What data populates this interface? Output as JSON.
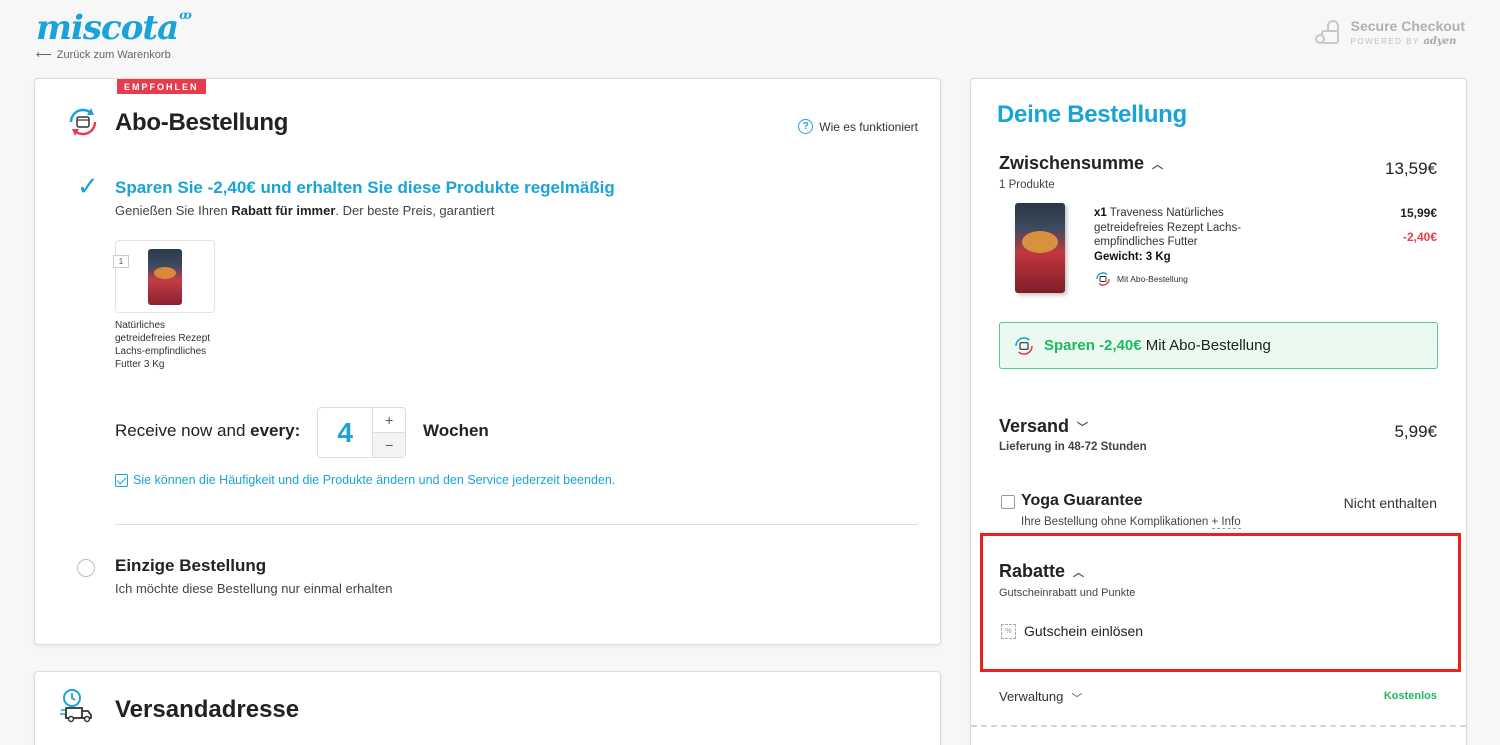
{
  "header": {
    "logo": "miscota",
    "back_link": "Zurück zum Warenkorb",
    "secure_title": "Secure Checkout",
    "secure_powered": "POWERED BY",
    "secure_brand": "adyen"
  },
  "abo": {
    "badge": "EMPFOHLEN",
    "title": "Abo-Bestellung",
    "how_link": "Wie es funktioniert",
    "save_title": "Sparen Sie -2,40€ und erhalten Sie diese Produkte regelmäßig",
    "save_sub_pre": "Genießen Sie Ihren ",
    "save_sub_bold": "Rabatt für immer",
    "save_sub_post": ". Der beste Preis, garantiert",
    "product_qty": "1",
    "product_name": "Natürliches getreidefreies Rezept Lachs-empfindliches Futter 3 Kg",
    "receive_pre": "Receive now and ",
    "receive_bold": "every:",
    "interval_value": "4",
    "plus": "+",
    "minus": "−",
    "interval_unit": "Wochen",
    "freq_note": "Sie können die Häufigkeit und die Produkte ändern und den Service jederzeit beenden.",
    "single_title": "Einzige Bestellung",
    "single_sub": "Ich möchte diese Bestellung nur einmal erhalten"
  },
  "shipping_card": {
    "title": "Versandadresse"
  },
  "order": {
    "title": "Deine Bestellung",
    "subtotal_label": "Zwischensumme",
    "subtotal_count": "1 Produkte",
    "subtotal_amount": "13,59€",
    "item_qty": "x1",
    "item_name": "Traveness Natürliches getreidefreies Rezept Lachs-empfindliches Futter",
    "item_weight": "Gewicht: 3 Kg",
    "item_abo": "Mit Abo-Bestellung",
    "item_price": "15,99€",
    "item_discount": "-2,40€",
    "save_box_bold": "Sparen -2,40€",
    "save_box_text": " Mit Abo-Bestellung",
    "shipping_label": "Versand",
    "shipping_sub": "Lieferung in 48-72 Stunden",
    "shipping_amount": "5,99€",
    "yoga_title": "Yoga Guarantee",
    "yoga_sub": "Ihre Bestellung ohne Komplikationen ",
    "yoga_info": "+ Info",
    "yoga_status": "Nicht enthalten",
    "discounts_label": "Rabatte",
    "discounts_sub": "Gutscheinrabatt und Punkte",
    "coupon_label": "Gutschein einlösen",
    "admin_label": "Verwaltung",
    "admin_value": "Kostenlos"
  },
  "colors": {
    "accent": "#1aa3d8",
    "badge": "#e73c4e",
    "success": "#20b860",
    "highlight": "#e8221f"
  },
  "icons": [
    "abo-cycle-icon",
    "question-icon",
    "check-icon",
    "delivery-clock-icon",
    "chevron-up-icon",
    "chevron-down-icon",
    "coupon-icon",
    "lock-key-icon"
  ]
}
